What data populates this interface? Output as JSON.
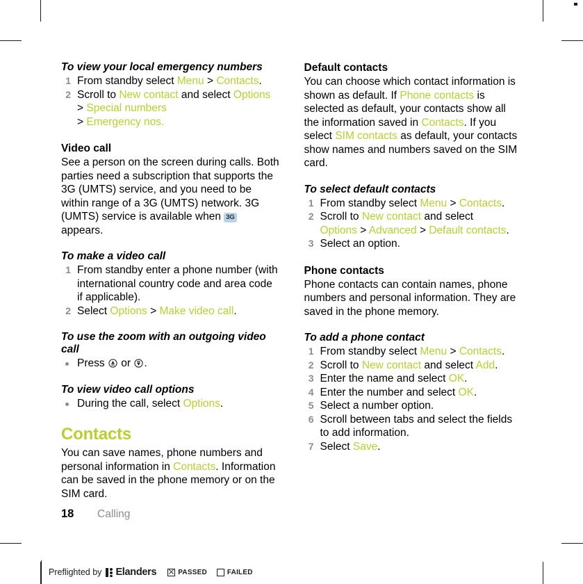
{
  "accent_color": "#b9cf2f",
  "muted_color": "#8c8c8c",
  "badge_color": "#b9d4ea",
  "left_column": {
    "s1": {
      "heading": "To view your local emergency numbers",
      "step1_a": "From standby select ",
      "step1_menu": "Menu",
      "step1_gt": " > ",
      "step1_contacts": "Contacts",
      "step1_end": ".",
      "step2_a": "Scroll to ",
      "step2_newcontact": "New contact",
      "step2_b": " and select ",
      "step2_options": "Options",
      "step2_gt1": " > ",
      "step2_special": "Special numbers",
      "step2_gt2": "> ",
      "step2_emergency": "Emergency nos.",
      "step2_end": ""
    },
    "s2": {
      "heading": "Video call",
      "body_a": "See a person on the screen during calls. Both parties need a subscription that supports the 3G (UMTS) service, and you need to be within range of a 3G (UMTS) network. 3G (UMTS) service is available when ",
      "badge": "3G",
      "body_b": " appears."
    },
    "s3": {
      "heading": "To make a video call",
      "step1": "From standby enter a phone number (with international country code and area code if applicable).",
      "step2_a": "Select ",
      "step2_options": "Options",
      "step2_gt": " > ",
      "step2_make": "Make video call",
      "step2_end": "."
    },
    "s4": {
      "heading": "To use the zoom with an outgoing video call",
      "bullet_a": "Press ",
      "bullet_key_up": "nav-key-up-icon",
      "bullet_b": " or ",
      "bullet_key_down": "nav-key-down-icon",
      "bullet_end": "."
    },
    "s5": {
      "heading": "To view video call options",
      "bullet_a": "During the call, select ",
      "bullet_options": "Options",
      "bullet_end": "."
    },
    "s6": {
      "heading": "Contacts",
      "body_a": "You can save names, phone numbers and personal information in ",
      "body_contacts": "Contacts",
      "body_b": ". Information can be saved in the phone memory or on the SIM card."
    }
  },
  "right_column": {
    "s1": {
      "heading": "Default contacts",
      "body_a": "You can choose which contact information is shown as default. If ",
      "phone_contacts": "Phone contacts",
      "body_b": " is selected as default, your contacts show all the information saved in ",
      "contacts": "Contacts",
      "body_c": ". If you select ",
      "sim_contacts": "SIM contacts",
      "body_d": " as default, your contacts show names and numbers saved on the SIM card."
    },
    "s2": {
      "heading": "To select default contacts",
      "step1_a": "From standby select ",
      "step1_menu": "Menu",
      "step1_gt": " > ",
      "step1_contacts": "Contacts",
      "step1_end": ".",
      "step2_a": "Scroll to ",
      "step2_newcontact": "New contact",
      "step2_b": " and select ",
      "step2_options": "Options",
      "step2_gt1": " > ",
      "step2_advanced": "Advanced",
      "step2_gt2": " > ",
      "step2_default": "Default contacts",
      "step2_end": ".",
      "step3": "Select an option."
    },
    "s3": {
      "heading": "Phone contacts",
      "body": "Phone contacts can contain names, phone numbers and personal information. They are saved in the phone memory."
    },
    "s4": {
      "heading": "To add a phone contact",
      "step1_a": "From standby select ",
      "step1_menu": "Menu",
      "step1_gt": " > ",
      "step1_contacts": "Contacts",
      "step1_end": ".",
      "step2_a": "Scroll to ",
      "step2_newcontact": "New contact",
      "step2_b": " and select ",
      "step2_add": "Add",
      "step2_end": ".",
      "step3_a": "Enter the name and select ",
      "step3_ok": "OK",
      "step3_end": ".",
      "step4_a": "Enter the number and select ",
      "step4_ok": "OK",
      "step4_end": ".",
      "step5": "Select a number option.",
      "step6": "Scroll between tabs and select the fields to add information.",
      "step7_a": "Select ",
      "step7_save": "Save",
      "step7_end": "."
    }
  },
  "footer": {
    "page_number": "18",
    "section": "Calling"
  },
  "preflight": {
    "text": "Preflighted by",
    "brand": "Elanders",
    "passed_label": "PASSED",
    "failed_label": "FAILED"
  }
}
